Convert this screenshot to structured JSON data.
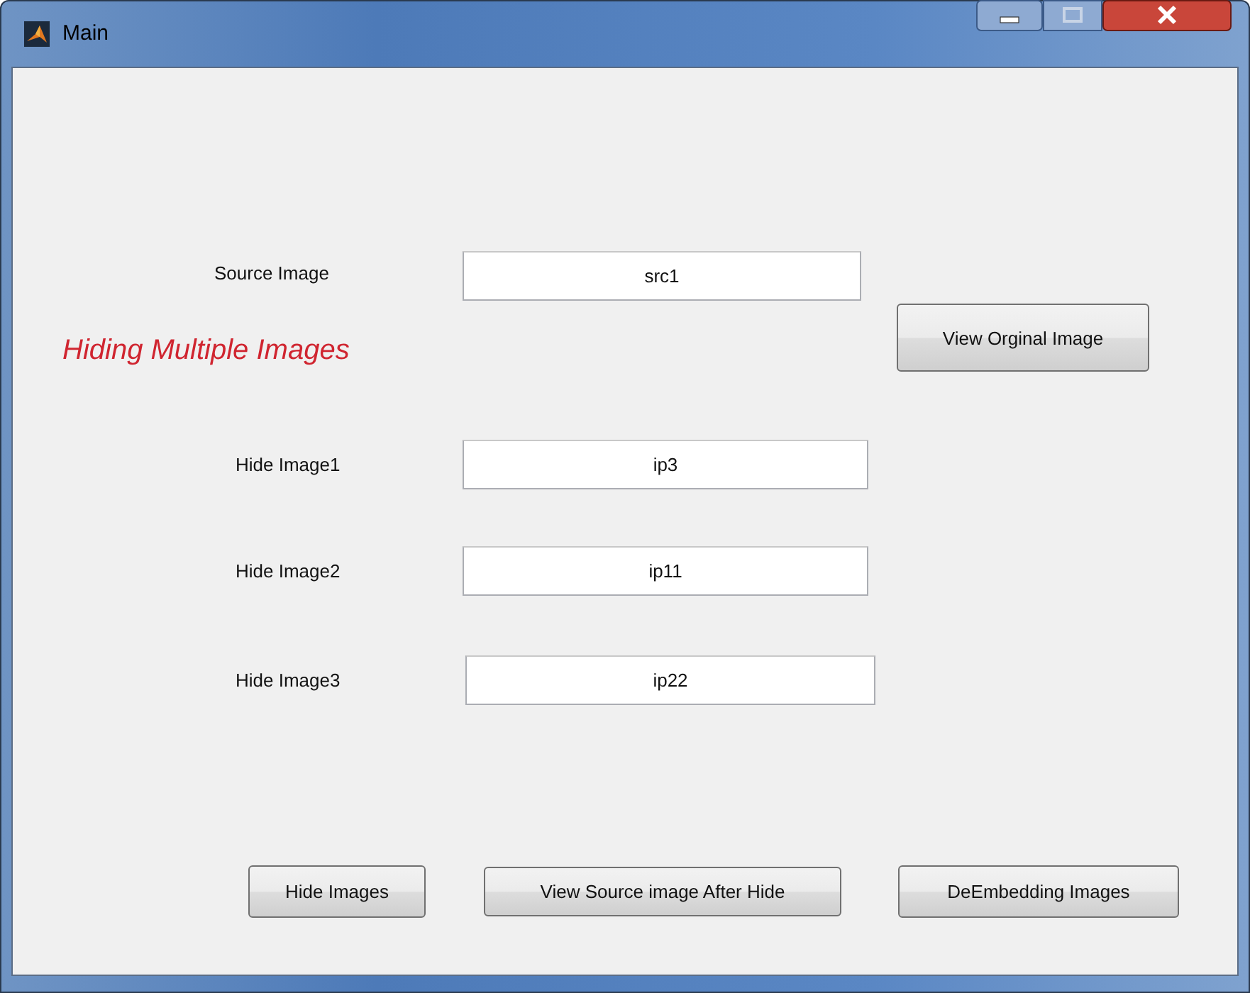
{
  "window": {
    "title": "Main"
  },
  "heading": "Hiding Multiple Images",
  "fields": [
    {
      "label": "Source Image",
      "value": "src1"
    },
    {
      "label": "Hide Image1",
      "value": "ip3"
    },
    {
      "label": "Hide Image2",
      "value": "ip11"
    },
    {
      "label": "Hide Image3",
      "value": "ip22"
    }
  ],
  "side_button": "View Orginal Image",
  "buttons": [
    "Hide Images",
    "View Source image After Hide",
    "DeEmbedding Images"
  ]
}
